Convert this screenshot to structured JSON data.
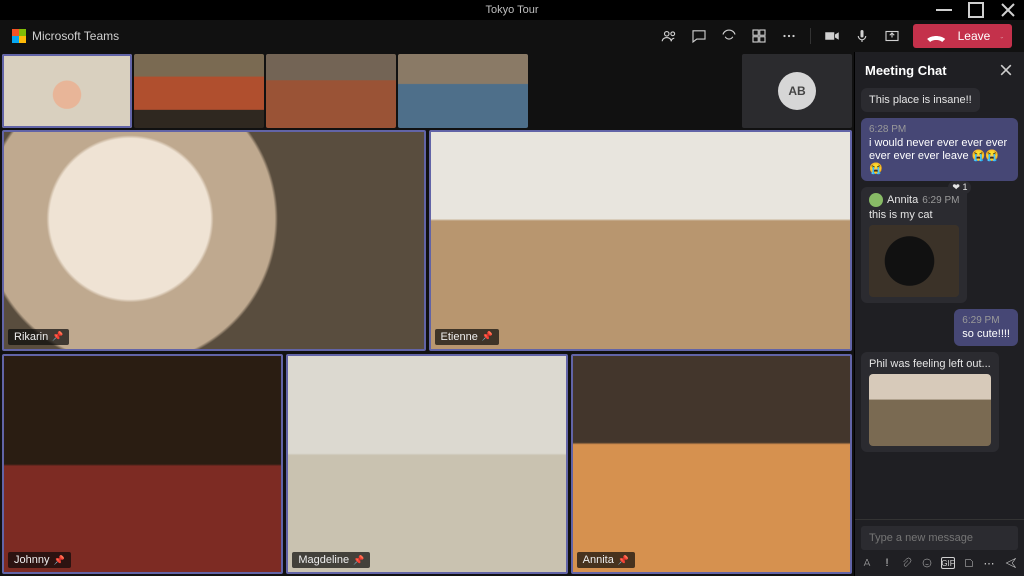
{
  "window": {
    "title": "Tokyo Tour"
  },
  "brand": {
    "label": "Microsoft Teams"
  },
  "toolbar": {
    "leave_label": "Leave"
  },
  "avatar_tile": {
    "initials": "AB"
  },
  "participants": {
    "large": [
      {
        "name": "Rikarin"
      },
      {
        "name": "Etienne"
      }
    ],
    "row": [
      {
        "name": "Johnny"
      },
      {
        "name": "Magdeline"
      },
      {
        "name": "Annita"
      }
    ]
  },
  "chat": {
    "title": "Meeting Chat",
    "messages": [
      {
        "kind": "in",
        "text": "This place is insane!!"
      },
      {
        "kind": "out",
        "time": "6:28 PM",
        "text": "i would never ever ever ever ever ever ever leave 😭😭😭"
      },
      {
        "kind": "in",
        "author": "Annita",
        "time": "6:29 PM",
        "text": "this is my cat",
        "attachment": "cat1",
        "reaction": "❤ 1"
      },
      {
        "kind": "out",
        "time": "6:29 PM",
        "text": "so cute!!!!"
      },
      {
        "kind": "in",
        "text": "Phil was feeling left out...",
        "attachment": "cat2"
      }
    ],
    "composer_placeholder": "Type a new message"
  }
}
